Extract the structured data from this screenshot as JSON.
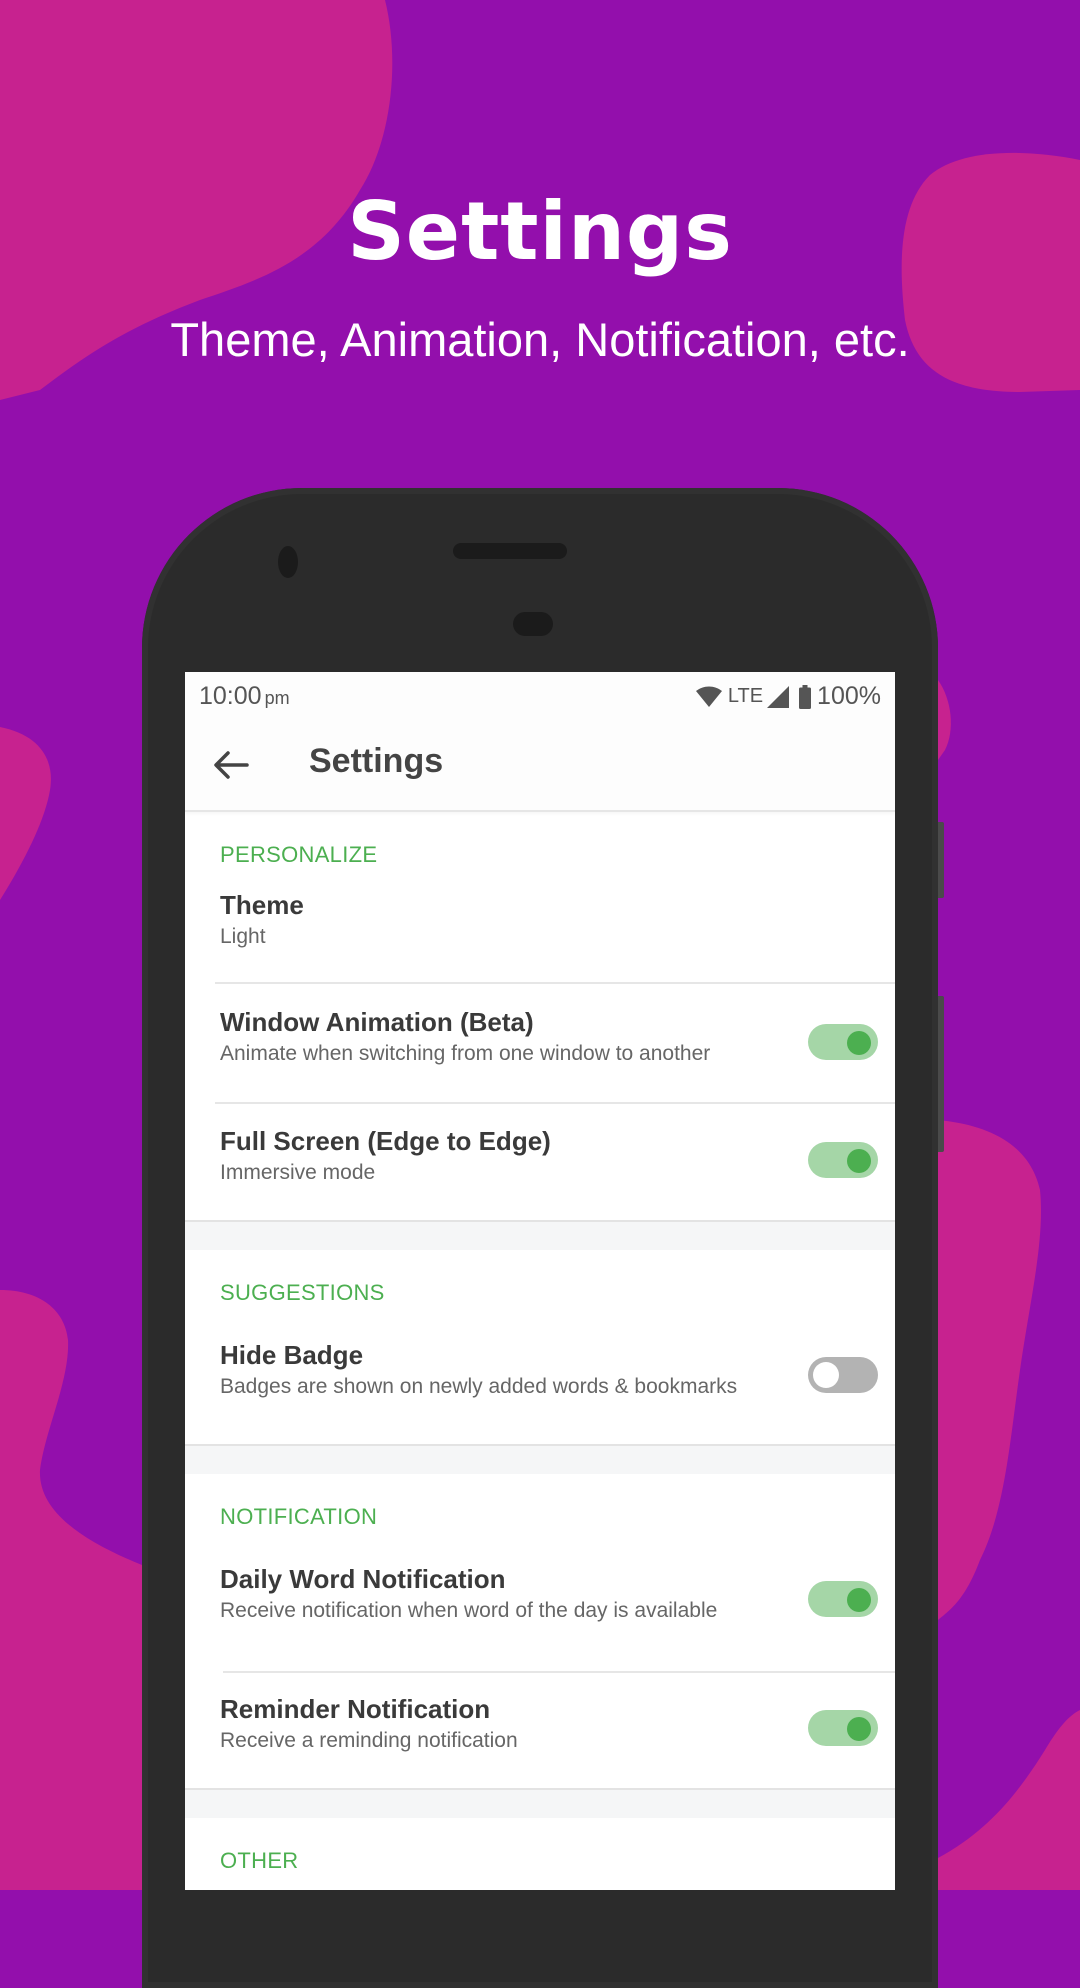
{
  "promo": {
    "title": "Settings",
    "subtitle": "Theme, Animation, Notification, etc."
  },
  "colors": {
    "background": "#930fac",
    "blob": "#c7228f",
    "accent": "#4caf50",
    "toggle_track_on": "#a5d6a7",
    "toggle_track_off": "#b3b3b3",
    "phone_body": "#2b2b2b"
  },
  "status_bar": {
    "time": "10:00",
    "ampm": "pm",
    "network": "LTE",
    "battery": "100%",
    "icons": [
      "wifi-icon",
      "signal-icon",
      "battery-icon"
    ]
  },
  "app_bar": {
    "back_icon": "arrow-left-icon",
    "title": "Settings"
  },
  "sections": [
    {
      "header": "PERSONALIZE",
      "items": [
        {
          "title": "Theme",
          "summary": "Light"
        },
        {
          "title": "Window Animation (Beta)",
          "summary": "Animate when switching from one window to another",
          "toggle": true
        },
        {
          "title": "Full Screen (Edge to Edge)",
          "summary": "Immersive mode",
          "toggle": true
        }
      ]
    },
    {
      "header": "SUGGESTIONS",
      "items": [
        {
          "title": "Hide Badge",
          "summary": "Badges are shown on newly added words & bookmarks",
          "toggle": false
        }
      ]
    },
    {
      "header": "NOTIFICATION",
      "items": [
        {
          "title": "Daily Word Notification",
          "summary": "Receive notification when word of the day is available",
          "toggle": true
        },
        {
          "title": "Reminder Notification",
          "summary": "Receive a reminding notification",
          "toggle": true
        }
      ]
    },
    {
      "header": "OTHER",
      "items": []
    }
  ]
}
